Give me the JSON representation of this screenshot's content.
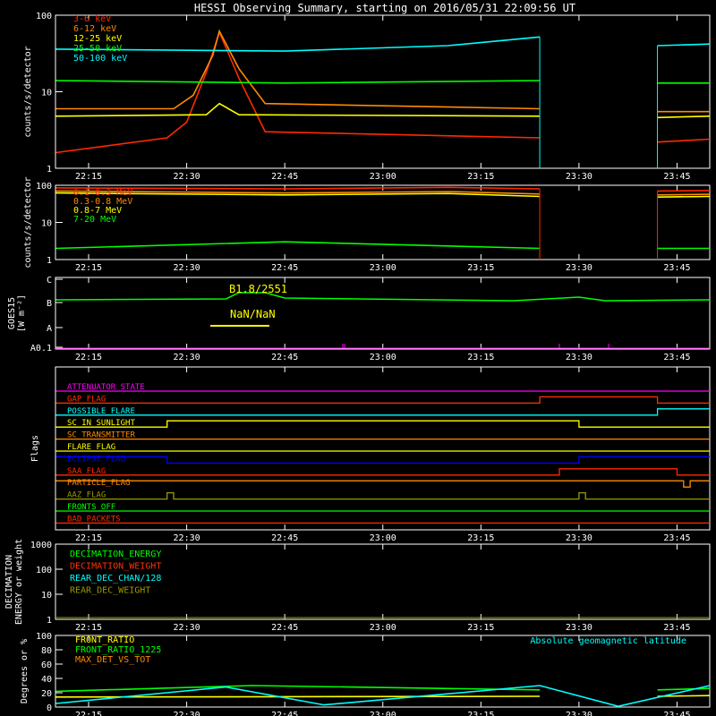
{
  "title": "HESSI Observing Summary, starting on 2016/05/31 22:09:56 UT",
  "time_ticks": [
    "22:15",
    "22:30",
    "22:45",
    "23:00",
    "23:15",
    "23:30",
    "23:45"
  ],
  "gap": {
    "start": "23:24",
    "end": "23:42"
  },
  "panels": {
    "xray": {
      "ylabel": "counts/s/detector",
      "y_ticks": [
        "1",
        "10",
        "100"
      ],
      "legend": [
        {
          "label": "3-6 keV",
          "color": "#ff2a00"
        },
        {
          "label": "6-12 keV",
          "color": "#ff8a00"
        },
        {
          "label": "12-25 keV",
          "color": "#ffff00"
        },
        {
          "label": "25-50 keV",
          "color": "#00ff00"
        },
        {
          "label": "50-100 keV",
          "color": "#00ffff"
        }
      ]
    },
    "gamma": {
      "ylabel": "counts/s/detector",
      "y_ticks": [
        "1",
        "10",
        "100"
      ],
      "legend": [
        {
          "label": "0.1-0.3 MeV",
          "color": "#ff2a00"
        },
        {
          "label": "0.3-0.8 MeV",
          "color": "#ff8a00"
        },
        {
          "label": "0.8-7 MeV",
          "color": "#ffff00"
        },
        {
          "label": "7-20 MeV",
          "color": "#00ff00"
        }
      ]
    },
    "goes": {
      "ylabel": "GOES15",
      "ylabel2": "[W m⁻²]",
      "y_ticks": [
        "A0.1",
        "A",
        "B",
        "C"
      ],
      "peak_label": "B1.8/2551",
      "ratio_label": "NaN/NaN"
    },
    "flags": {
      "ylabel": "Flags",
      "items": [
        {
          "label": "ATTENUATOR_STATE",
          "color": "#ff00ff"
        },
        {
          "label": "GAP_FLAG",
          "color": "#ff3300"
        },
        {
          "label": "POSSIBLE_FLARE",
          "color": "#00ffff"
        },
        {
          "label": "SC_IN_SUNLIGHT",
          "color": "#ffff00"
        },
        {
          "label": "SC_TRANSMITTER",
          "color": "#ff8a00"
        },
        {
          "label": "FLARE_FLAG",
          "color": "#ffff00"
        },
        {
          "label": "ECLIPSE_FLAG",
          "color": "#0000ff"
        },
        {
          "label": "SAA_FLAG",
          "color": "#ff2a00"
        },
        {
          "label": "PARTICLE_FLAG",
          "color": "#ff8a00"
        },
        {
          "label": "AAZ_FLAG",
          "color": "#999900"
        },
        {
          "label": "FRONTS_OFF",
          "color": "#00ff00"
        },
        {
          "label": "BAD_PACKETS",
          "color": "#ff2a00"
        }
      ]
    },
    "decimation": {
      "ylabel": "DECIMATION",
      "ylabel2": "ENERGY or weight",
      "y_ticks": [
        "1",
        "10",
        "100",
        "1000"
      ],
      "legend": [
        {
          "label": "DECIMATION_ENERGY",
          "color": "#00ff00"
        },
        {
          "label": "DECIMATION_WEIGHT",
          "color": "#ff3300"
        },
        {
          "label": "REAR_DEC_CHAN/128",
          "color": "#00ffff"
        },
        {
          "label": "REAR_DEC_WEIGHT",
          "color": "#999900"
        }
      ]
    },
    "ratio": {
      "ylabel": "Degrees or %",
      "y_ticks": [
        "0",
        "20",
        "40",
        "60",
        "80",
        "100"
      ],
      "legend": [
        {
          "label": "FRONT_RATIO",
          "color": "#ffff00"
        },
        {
          "label": "FRONT_RATIO_1225",
          "color": "#00ff00"
        },
        {
          "label": "MAX_DET_VS_TOT",
          "color": "#ff8a00"
        }
      ],
      "right_label": "Absolute geomagnetic latitude",
      "right_label_color": "#00ffff"
    }
  },
  "chart_data": {
    "type": "line",
    "x_range": [
      "22:09:56",
      "23:50:00"
    ],
    "x_unit": "UT",
    "series": [
      {
        "panel": "xray",
        "name": "3-6 keV",
        "scale": "log",
        "ylim": [
          1,
          100
        ],
        "segments": [
          {
            "t": [
              "22:10",
              "22:27",
              "22:30",
              "22:33",
              "22:35",
              "22:38",
              "22:42",
              "23:24"
            ],
            "y": [
              1.6,
              2.5,
              4,
              18,
              60,
              15,
              3,
              2.5
            ]
          },
          {
            "t": [
              "23:42",
              "23:50"
            ],
            "y": [
              2.2,
              2.4
            ]
          }
        ]
      },
      {
        "panel": "xray",
        "name": "6-12 keV",
        "scale": "log",
        "ylim": [
          1,
          100
        ],
        "segments": [
          {
            "t": [
              "22:10",
              "22:28",
              "22:31",
              "22:34",
              "22:35",
              "22:38",
              "22:42",
              "23:24"
            ],
            "y": [
              6,
              6,
              9,
              30,
              62,
              20,
              7,
              6
            ]
          },
          {
            "t": [
              "23:42",
              "23:50"
            ],
            "y": [
              5.5,
              5.5
            ]
          }
        ]
      },
      {
        "panel": "xray",
        "name": "12-25 keV",
        "scale": "log",
        "ylim": [
          1,
          100
        ],
        "segments": [
          {
            "t": [
              "22:10",
              "22:33",
              "22:35",
              "22:38",
              "23:24"
            ],
            "y": [
              4.8,
              5,
              7,
              5,
              4.8
            ]
          },
          {
            "t": [
              "23:42",
              "23:50"
            ],
            "y": [
              4.6,
              4.8
            ]
          }
        ]
      },
      {
        "panel": "xray",
        "name": "25-50 keV",
        "scale": "log",
        "ylim": [
          1,
          100
        ],
        "segments": [
          {
            "t": [
              "22:10",
              "22:45",
              "23:24"
            ],
            "y": [
              14,
              13,
              14
            ]
          },
          {
            "t": [
              "23:42",
              "23:50"
            ],
            "y": [
              13,
              13
            ]
          }
        ]
      },
      {
        "panel": "xray",
        "name": "50-100 keV",
        "scale": "log",
        "ylim": [
          1,
          100
        ],
        "segments": [
          {
            "t": [
              "22:10",
              "22:45",
              "23:10",
              "23:24"
            ],
            "y": [
              36,
              34,
              40,
              52
            ]
          },
          {
            "t": [
              "23:42",
              "23:50"
            ],
            "y": [
              40,
              42
            ]
          }
        ]
      },
      {
        "panel": "gamma",
        "name": "0.1-0.3 MeV",
        "scale": "log",
        "ylim": [
          1,
          100
        ],
        "segments": [
          {
            "t": [
              "22:10",
              "22:45",
              "23:10",
              "23:24"
            ],
            "y": [
              85,
              80,
              88,
              80
            ]
          },
          {
            "t": [
              "23:42",
              "23:50"
            ],
            "y": [
              70,
              72
            ]
          }
        ]
      },
      {
        "panel": "gamma",
        "name": "0.3-0.8 MeV",
        "scale": "log",
        "ylim": [
          1,
          100
        ],
        "segments": [
          {
            "t": [
              "22:10",
              "22:45",
              "23:10",
              "23:24"
            ],
            "y": [
              70,
              62,
              68,
              58
            ]
          },
          {
            "t": [
              "23:42",
              "23:50"
            ],
            "y": [
              55,
              57
            ]
          }
        ]
      },
      {
        "panel": "gamma",
        "name": "0.8-7 MeV",
        "scale": "log",
        "ylim": [
          1,
          100
        ],
        "segments": [
          {
            "t": [
              "22:10",
              "22:45",
              "23:10",
              "23:24"
            ],
            "y": [
              62,
              55,
              60,
              50
            ]
          },
          {
            "t": [
              "23:42",
              "23:50"
            ],
            "y": [
              48,
              50
            ]
          }
        ]
      },
      {
        "panel": "gamma",
        "name": "7-20 MeV",
        "scale": "log",
        "ylim": [
          1,
          100
        ],
        "segments": [
          {
            "t": [
              "22:10",
              "22:45",
              "23:24"
            ],
            "y": [
              2,
              3,
              2
            ]
          },
          {
            "t": [
              "23:42",
              "23:50"
            ],
            "y": [
              2,
              2
            ]
          }
        ]
      },
      {
        "panel": "ratio",
        "name": "FRONT_RATIO",
        "scale": "linear",
        "ylim": [
          0,
          100
        ],
        "segments": [
          {
            "t": [
              "22:10",
              "23:24"
            ],
            "y": [
              14,
              15
            ]
          },
          {
            "t": [
              "23:42",
              "23:50"
            ],
            "y": [
              15,
              16
            ]
          }
        ]
      },
      {
        "panel": "ratio",
        "name": "FRONT_RATIO_1225",
        "scale": "linear",
        "ylim": [
          0,
          100
        ],
        "segments": [
          {
            "t": [
              "22:10",
              "22:40",
              "23:24"
            ],
            "y": [
              22,
              30,
              24
            ]
          },
          {
            "t": [
              "23:42",
              "23:50"
            ],
            "y": [
              24,
              26
            ]
          }
        ]
      },
      {
        "panel": "ratio",
        "name": "Absolute geomagnetic latitude",
        "scale": "linear",
        "ylim": [
          0,
          100
        ],
        "segments": [
          {
            "t": [
              "22:10",
              "22:36",
              "22:51",
              "23:24",
              "23:36",
              "23:50"
            ],
            "y": [
              5,
              28,
              3,
              30,
              1,
              30
            ]
          }
        ]
      }
    ]
  }
}
